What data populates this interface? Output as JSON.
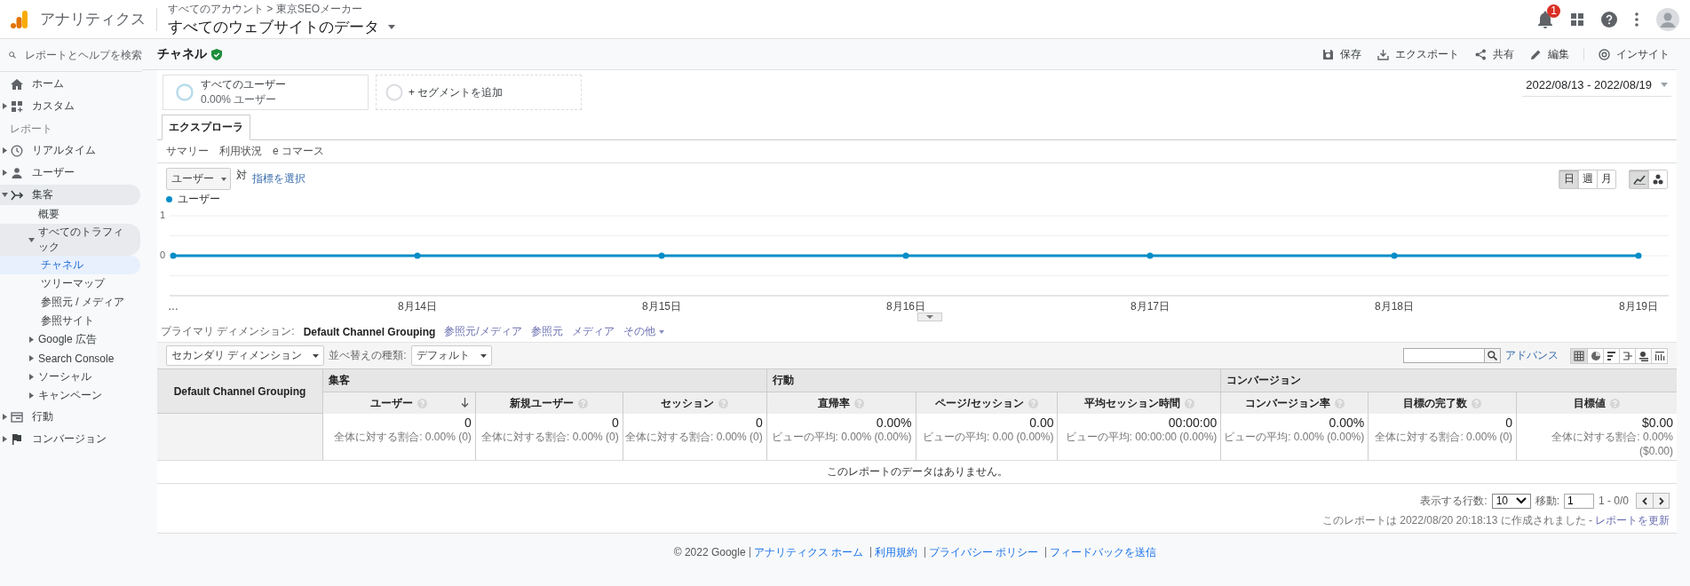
{
  "header": {
    "product": "アナリティクス",
    "breadcrumb": "すべてのアカウント > 東京SEOメーカー",
    "property": "すべてのウェブサイトのデータ",
    "notification_count": "1"
  },
  "sidebar": {
    "search": {
      "placeholder": "レポートとヘルプを検索"
    },
    "items": [
      {
        "kind": "link",
        "label": "ホーム",
        "selected": false
      },
      {
        "kind": "group",
        "label": "カスタム",
        "expanded": false,
        "selected": false
      },
      {
        "kind": "section",
        "label": "レポート"
      },
      {
        "kind": "group",
        "label": "リアルタイム",
        "expanded": false,
        "selected": false
      },
      {
        "kind": "group",
        "label": "ユーザー",
        "expanded": false,
        "selected": false
      },
      {
        "kind": "group",
        "label": "集客",
        "expanded": true,
        "selected": false,
        "children": [
          {
            "kind": "link",
            "label": "概要",
            "selected": false
          },
          {
            "kind": "group",
            "label": "すべてのトラフィック",
            "expanded": true,
            "selected": false,
            "children": [
              {
                "kind": "link",
                "label": "チャネル",
                "selected": true
              },
              {
                "kind": "link",
                "label": "ツリーマップ",
                "selected": false
              },
              {
                "kind": "link",
                "label": "参照元 / メディア",
                "selected": false
              },
              {
                "kind": "link",
                "label": "参照サイト",
                "selected": false
              }
            ]
          },
          {
            "kind": "group",
            "label": "Google 広告",
            "expanded": false,
            "selected": false
          },
          {
            "kind": "group",
            "label": "Search Console",
            "expanded": false,
            "selected": false
          },
          {
            "kind": "group",
            "label": "ソーシャル",
            "expanded": false,
            "selected": false
          },
          {
            "kind": "group",
            "label": "キャンペーン",
            "expanded": false,
            "selected": false
          }
        ]
      },
      {
        "kind": "group",
        "label": "行動",
        "expanded": false,
        "selected": false
      },
      {
        "kind": "group",
        "label": "コンバージョン",
        "expanded": false,
        "selected": false
      }
    ]
  },
  "toolbar": {
    "title": "チャネル",
    "actions": [
      "保存",
      "エクスポート",
      "共有",
      "編集",
      "インサイト"
    ]
  },
  "segments": [
    {
      "kind": "segment",
      "name": "すべてのユーザー",
      "share": "0.00% ユーザー"
    },
    {
      "kind": "add",
      "name": "+ セグメントを追加"
    }
  ],
  "date_range": "2022/08/13 - 2022/08/19",
  "tabs": [
    {
      "label": "エクスプローラ",
      "selected": true
    }
  ],
  "subtabs": [
    "サマリー",
    "利用状況",
    "e コマース"
  ],
  "metric": {
    "value": "ユーザー",
    "versus": "対",
    "link": "指標を選択"
  },
  "granularity": [
    {
      "label": "日",
      "selected": true
    },
    {
      "label": "週",
      "selected": false
    },
    {
      "label": "月",
      "selected": false
    }
  ],
  "chart_types": [
    {
      "selected": true
    },
    {
      "selected": false
    }
  ],
  "chart": {
    "chart_data": {
      "type": "line",
      "categories": [
        "…",
        "8月14日",
        "8月15日",
        "8月16日",
        "8月17日",
        "8月18日",
        "8月19日"
      ],
      "series": [
        {
          "name": "ユーザー",
          "color": "#058dc7",
          "marker": "circle",
          "values": [
            0,
            0,
            0,
            0,
            0,
            0,
            0
          ]
        }
      ],
      "ylim": [
        -1,
        1
      ],
      "yticks": [
        0,
        1
      ]
    }
  },
  "dimensions": {
    "label": "プライマリ ディメンション:",
    "options": [
      {
        "label": "Default Channel Grouping",
        "selected": true
      },
      {
        "label": "参照元/メディア",
        "selected": false
      },
      {
        "label": "参照元",
        "selected": false
      },
      {
        "label": "メディア",
        "selected": false
      },
      {
        "label": "その他",
        "selected": false
      }
    ]
  },
  "secondary": {
    "dimension": "セカンダリ ディメンション",
    "sort_label": "並べ替えの種類:",
    "sort": "デフォルト"
  },
  "table_tools": {
    "advanced": "アドバンス",
    "views": [
      {
        "selected": true
      },
      {
        "selected": false
      },
      {
        "selected": false
      },
      {
        "selected": false
      },
      {
        "selected": false
      },
      {
        "selected": false
      }
    ]
  },
  "table": {
    "dimension_header": "Default Channel Grouping",
    "groups": [
      {
        "label": "集客",
        "columns": [
          {
            "label": "ユーザー",
            "sorted": true,
            "value": "0",
            "note": "全体に対する割合: 0.00% (0)"
          },
          {
            "label": "新規ユーザー",
            "sorted": false,
            "value": "0",
            "note": "全体に対する割合: 0.00% (0)"
          },
          {
            "label": "セッション",
            "sorted": false,
            "value": "0",
            "note": "全体に対する割合: 0.00% (0)"
          }
        ]
      },
      {
        "label": "行動",
        "columns": [
          {
            "label": "直帰率",
            "sorted": false,
            "value": "0.00%",
            "note": "ビューの平均: 0.00% (0.00%)"
          },
          {
            "label": "ページ/セッション",
            "sorted": false,
            "value": "0.00",
            "note": "ビューの平均: 0.00 (0.00%)"
          },
          {
            "label": "平均セッション時間",
            "sorted": false,
            "value": "00:00:00",
            "note": "ビューの平均: 00:00:00 (0.00%)"
          }
        ]
      },
      {
        "label": "コンバージョン",
        "columns": [
          {
            "label": "コンバージョン率",
            "sorted": false,
            "value": "0.00%",
            "note": "ビューの平均: 0.00% (0.00%)"
          },
          {
            "label": "目標の完了数",
            "sorted": false,
            "value": "0",
            "note": "全体に対する割合: 0.00% (0)"
          },
          {
            "label": "目標値",
            "sorted": false,
            "value": "$0.00",
            "note": "全体に対する割合: 0.00% ($0.00)"
          }
        ]
      }
    ],
    "empty_message": "このレポートのデータはありません。"
  },
  "pagination": {
    "rows_label": "表示する行数:",
    "rows": "10",
    "goto_label": "移動:",
    "page": "1",
    "range": "1 - 0/0"
  },
  "report_note": {
    "text": "このレポートは 2022/08/20 20:18:13 に作成されました -",
    "link": "レポートを更新"
  },
  "footer": {
    "copyright": "© 2022 Google",
    "links": [
      "アナリティクス ホーム",
      "利用規約",
      "プライバシー ポリシー",
      "フィードバックを送信"
    ]
  }
}
